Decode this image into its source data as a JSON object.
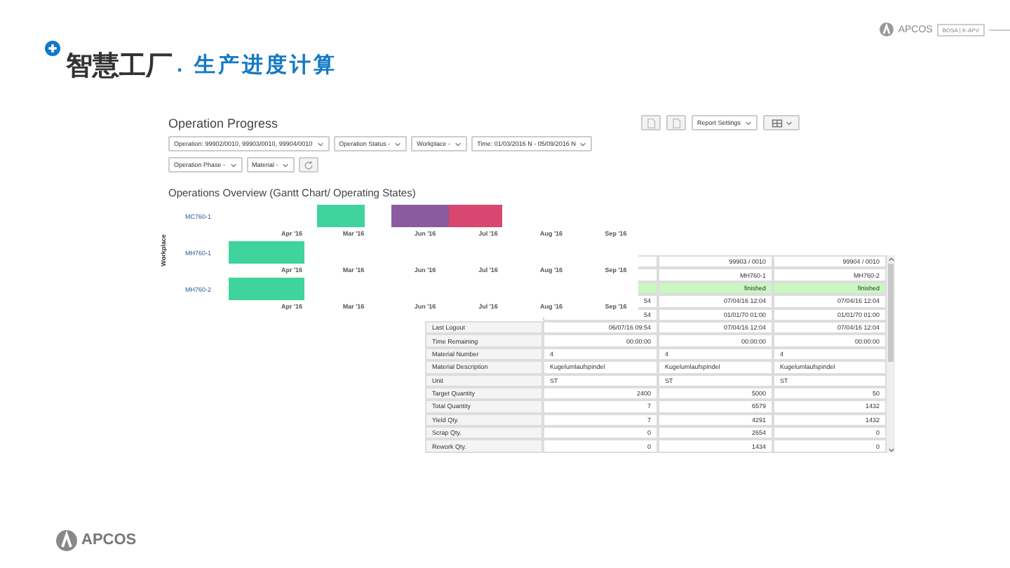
{
  "slide": {
    "title": "智慧工厂",
    "subtitle": ". 生产进度计算",
    "logo_top": "APCOS",
    "logo_tag": "BOSA | K-APV",
    "logo_bottom": "APCOS"
  },
  "app": {
    "title": "Operation Progress",
    "report_button": "Report Settings",
    "filter_rows": [
      [
        "Operation: 99902/0010, 99903/0010, 99904/0010",
        "Operation Status -",
        "Workplace -",
        "Time: 01/03/2016 N - 05/09/2016 N"
      ],
      [
        "Operation Phase -",
        "Material -"
      ]
    ],
    "chart_title": "Operations Overview (Gantt Chart/ Operating States)",
    "gantt": {
      "axis_label": "Workplace",
      "rows": [
        {
          "label": "MC760-1",
          "bars": [
            {
              "color": "#3fd49d"
            },
            {
              "color": "#8a5b9e"
            },
            {
              "color": "#d9466f"
            }
          ],
          "ticks": [
            "Apr '16",
            "Mar '16",
            "Jun '16",
            "Jul '16",
            "Aug '16",
            "Sep '16"
          ]
        },
        {
          "label": "MH760-1",
          "bars": [
            {
              "color": "#3fd49d"
            }
          ],
          "ticks": [
            "Apr '16",
            "Mar '16",
            "Jun '16",
            "Jul '16",
            "Aug '16",
            "Sep '16"
          ]
        },
        {
          "label": "MH760-2",
          "bars": [
            {
              "color": "#3fd49d"
            }
          ],
          "ticks": [
            "Apr '16",
            "Mar '16",
            "Jun '16",
            "Jul '16",
            "Aug '16",
            "Sep '16"
          ]
        }
      ]
    },
    "table": {
      "rows": [
        {
          "values": [
            "99903 / 0010",
            "99904 / 0010"
          ],
          "highlight": false
        },
        {
          "values": [
            "MH760-1",
            "MH760-2"
          ],
          "highlight": false
        },
        {
          "values": [
            "finished",
            "finished"
          ],
          "highlight": true
        },
        {
          "values": [
            "54",
            "07/04/16 12:04",
            "07/04/16 12:04"
          ],
          "highlight": false
        },
        {
          "values": [
            "54",
            "01/01/70 01:00",
            "01/01/70 01:00"
          ],
          "highlight": false
        },
        {
          "label": "Last Logout",
          "values": [
            "06/07/16 09:54",
            "07/04/16 12:04",
            "07/04/16 12:04"
          ],
          "highlight": false
        },
        {
          "label": "Time Remaining",
          "values": [
            "00:00:00",
            "00:00:00",
            "00:00:00"
          ],
          "highlight": false
        },
        {
          "label": "Material Number",
          "values": [
            "4",
            "4",
            "4"
          ],
          "highlight": false,
          "kind": "text"
        },
        {
          "label": "Material Description",
          "values": [
            "Kugelumlaufspindel",
            "Kugelumlaufspindel",
            "Kugelumlaufspindel"
          ],
          "highlight": false,
          "kind": "text"
        },
        {
          "label": "Unit",
          "values": [
            "ST",
            "ST",
            "ST"
          ],
          "highlight": false,
          "kind": "text"
        },
        {
          "label": "Target Quantity",
          "values": [
            "2400",
            "5000",
            "50"
          ],
          "highlight": false
        },
        {
          "label": "Total Quantity",
          "values": [
            "7",
            "6579",
            "1432"
          ],
          "highlight": false
        },
        {
          "label": "Yield Qty.",
          "values": [
            "7",
            "4291",
            "1432"
          ],
          "highlight": false
        },
        {
          "label": "Scrap Qty.",
          "values": [
            "0",
            "2654",
            "0"
          ],
          "highlight": false
        },
        {
          "label": "Rework Qty.",
          "values": [
            "0",
            "1434",
            "0"
          ],
          "highlight": false
        }
      ]
    }
  }
}
